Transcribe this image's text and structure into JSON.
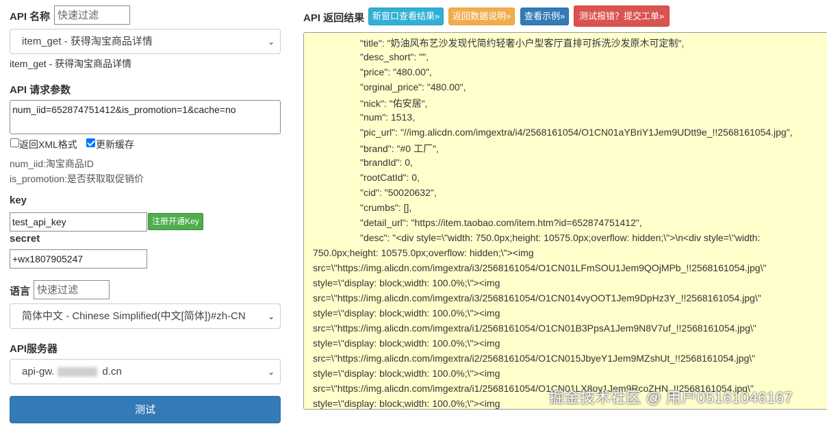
{
  "left": {
    "api_name_label": "API 名称",
    "api_name_filter_placeholder": "快速过滤",
    "api_select_value": "item_get - 获得淘宝商品详情",
    "api_select_caption": "item_get - 获得淘宝商品详情",
    "params_label": "API 请求参数",
    "params_value": "num_iid=652874751412&is_promotion=1&cache=no",
    "xml_checkbox_label": "返回XML格式",
    "xml_checked": false,
    "cache_checkbox_label": "更新缓存",
    "cache_checked": true,
    "hint_num_iid": "num_iid:淘宝商品ID",
    "hint_promotion": "is_promotion:是否获取取促销价",
    "key_label": "key",
    "key_value": "test_api_key",
    "register_key_button": "注册开通Key",
    "secret_label": "secret",
    "secret_value": "+wx1807905247",
    "lang_label": "语言",
    "lang_filter_placeholder": "快速过滤",
    "lang_select_value": "简体中文 - Chinese Simplified(中文[简体])#zh-CN",
    "server_label": "API服务器",
    "server_select_prefix": "api-gw.",
    "server_select_suffix": "d.cn",
    "test_button": "测试"
  },
  "right": {
    "title": "API 返回结果",
    "btn_new_window": "新窗口查看结果»",
    "btn_doc": "返回数据说明»",
    "btn_example": "查看示例»",
    "btn_report": "测试报错？提交工单»",
    "result_lines": [
      "\"title\": \"奶油风布艺沙发现代简约轻奢小户型客厅直排可拆洗沙发原木可定制\",",
      "\"desc_short\": \"\",",
      "\"price\": \"480.00\",",
      "\"orginal_price\": \"480.00\",",
      "\"nick\": \"佑安居\",",
      "\"num\": 1513,",
      "\"pic_url\": \"//img.alicdn.com/imgextra/i4/2568161054/O1CN01aYBriY1Jem9UDtt9e_!!2568161054.jpg\",",
      "\"brand\": \"#0 工厂\",",
      "\"brandId\": 0,",
      "\"rootCatId\": 0,",
      "\"cid\": \"50020632\",",
      "\"crumbs\": [],",
      "\"detail_url\": \"https://item.taobao.com/item.htm?id=652874751412\",",
      "\"desc\": \"<div style=\\\"width: 750.0px;height: 10575.0px;overflow: hidden;\\\">\\n<div style=\\\"width:",
      "750.0px;height: 10575.0px;overflow: hidden;\\\"><img",
      "src=\\\"https://img.alicdn.com/imgextra/i3/2568161054/O1CN01LFmSOU1Jem9QOjMPb_!!2568161054.jpg\\\"",
      "style=\\\"display: block;width: 100.0%;\\\"><img",
      "src=\\\"https://img.alicdn.com/imgextra/i3/2568161054/O1CN014vyOOT1Jem9DpHz3Y_!!2568161054.jpg\\\"",
      "style=\\\"display: block;width: 100.0%;\\\"><img",
      "src=\\\"https://img.alicdn.com/imgextra/i1/2568161054/O1CN01B3PpsA1Jem9N8V7uf_!!2568161054.jpg\\\"",
      "style=\\\"display: block;width: 100.0%;\\\"><img",
      "src=\\\"https://img.alicdn.com/imgextra/i2/2568161054/O1CN015JbyeY1Jem9MZshUt_!!2568161054.jpg\\\"",
      "style=\\\"display: block;width: 100.0%;\\\"><img",
      "src=\\\"https://img.alicdn.com/imgextra/i1/2568161054/O1CN01LX8oy1Jem9RcoZHN_!!2568161054.jpg\\\"",
      "style=\\\"display: block;width: 100.0%;\\\"><img"
    ]
  },
  "watermark": "掘金技术社区 @ 用户05161046167"
}
